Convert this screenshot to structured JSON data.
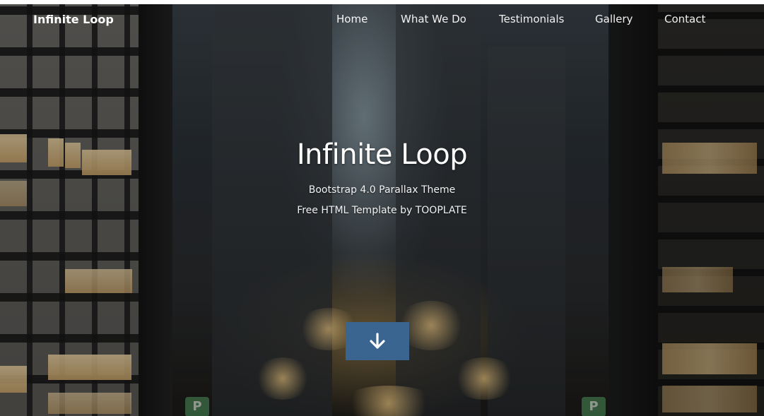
{
  "navbar": {
    "brand": "Infinite Loop",
    "links": [
      {
        "label": "Home",
        "active": true
      },
      {
        "label": "What We Do"
      },
      {
        "label": "Testimonials"
      },
      {
        "label": "Gallery"
      },
      {
        "label": "Contact"
      }
    ]
  },
  "hero": {
    "title": "Infinite Loop",
    "subtitle_1": "Bootstrap 4.0 Parallax Theme",
    "subtitle_2": "Free HTML Template by TOOPLATE",
    "scroll_button_icon": "arrow-down-icon"
  },
  "colors": {
    "scroll_button": "#3a6590",
    "text": "#ffffff"
  }
}
